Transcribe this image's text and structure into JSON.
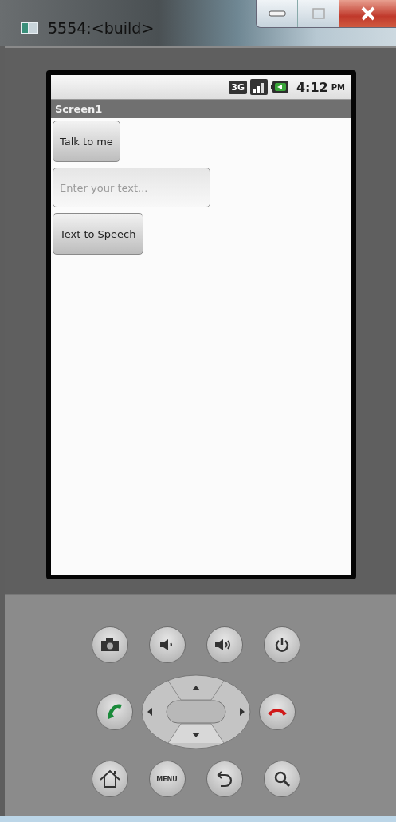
{
  "window": {
    "title": "5554:<build>"
  },
  "status_bar": {
    "network": "3G",
    "time": "4:12",
    "meridiem": "PM"
  },
  "app": {
    "title": "Screen1",
    "components": [
      {
        "kind": "button",
        "text": "Talk to me"
      },
      {
        "kind": "textbox",
        "placeholder": "Enter your text..."
      },
      {
        "kind": "button",
        "text": "Text to Speech"
      }
    ]
  },
  "keypad": {
    "menu_label": "MENU"
  }
}
